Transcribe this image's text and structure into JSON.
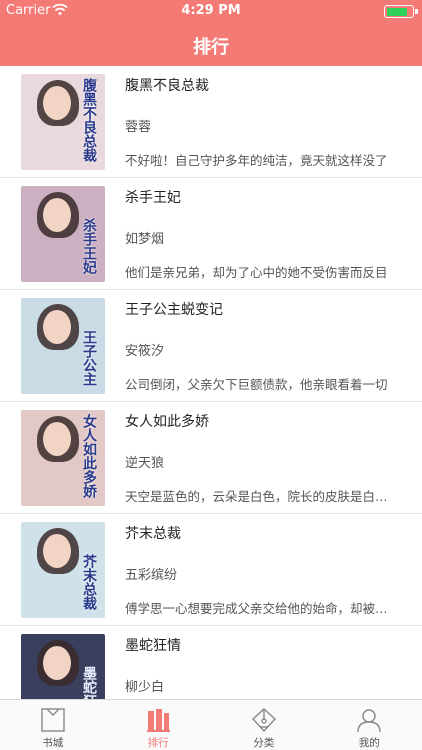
{
  "status_bar": {
    "carrier": "Carrier",
    "time": "4:29 PM",
    "battery_level": 0.85
  },
  "nav": {
    "title": "排行"
  },
  "books": [
    {
      "title": "腹黑不良总裁",
      "author": "蓉蓉",
      "desc": "不好啦！自己守护多年的纯洁，竟天就这样没了",
      "cover_text": "腹黑不良总裁",
      "cover_color": "#e9d9df"
    },
    {
      "title": "杀手王妃",
      "author": "如梦烟",
      "desc": "他们是亲兄弟，却为了心中的她不受伤害而反目",
      "cover_text": "杀手王妃",
      "cover_color": "#cbb0c2"
    },
    {
      "title": "王子公主蜕变记",
      "author": "安筱汐",
      "desc": "公司倒闭，父亲欠下巨额债款，他亲眼看着一切",
      "cover_text": "王子公主",
      "cover_color": "#c9dbe5"
    },
    {
      "title": "女人如此多娇",
      "author": "逆天狼",
      "desc": "天空是蓝色的，云朵是白色，院长的皮肤是白色的",
      "cover_text": "女人如此多娇",
      "cover_color": "#e2c8c6"
    },
    {
      "title": "芥末总裁",
      "author": "五彩缤纷",
      "desc": "傅学思一心想要完成父亲交给他的始命，却被…",
      "cover_text": "芥末总裁",
      "cover_color": "#cfe2ea"
    },
    {
      "title": "墨蛇狂情",
      "author": "柳少白",
      "desc": "",
      "cover_text": "墨蛇狂情",
      "cover_color": "#3a3f5e"
    }
  ],
  "tabs": [
    {
      "label": "书城",
      "icon": "bookstore-icon"
    },
    {
      "label": "排行",
      "icon": "ranking-icon"
    },
    {
      "label": "分类",
      "icon": "category-icon"
    },
    {
      "label": "我的",
      "icon": "profile-icon"
    }
  ],
  "colors": {
    "accent": "#f47a75",
    "battery_green": "#2fd158",
    "divider": "#e4e4e4"
  }
}
